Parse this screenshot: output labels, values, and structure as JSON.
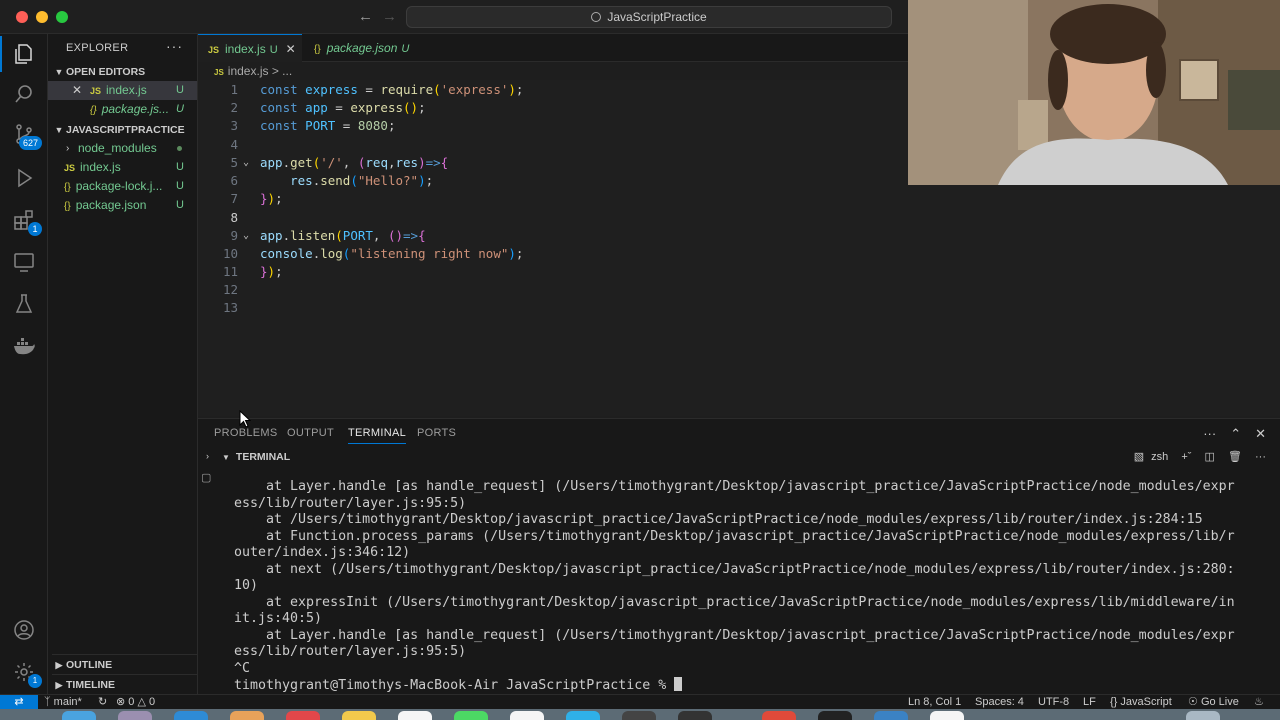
{
  "window": {
    "search_title": "JavaScriptPractice",
    "back_icon": "arrow-left-icon",
    "forward_icon": "arrow-right-icon"
  },
  "activity_bar": {
    "source_control_badge": "627",
    "extensions_badge": "1"
  },
  "sidebar": {
    "title": "EXPLORER",
    "open_editors_label": "OPEN EDITORS",
    "open_editors": [
      {
        "name": "index.js",
        "status": "U",
        "type": "js"
      },
      {
        "name": "package.js...",
        "status": "U",
        "type": "json"
      }
    ],
    "project_label": "JAVASCRIPTPRACTICE",
    "files": [
      {
        "name": "node_modules",
        "status": "",
        "type": "folder"
      },
      {
        "name": "index.js",
        "status": "U",
        "type": "js"
      },
      {
        "name": "package-lock.j...",
        "status": "U",
        "type": "json"
      },
      {
        "name": "package.json",
        "status": "U",
        "type": "json"
      }
    ],
    "outline_label": "OUTLINE",
    "timeline_label": "TIMELINE"
  },
  "tabs": [
    {
      "icon": "JS",
      "label": "index.js",
      "status": "U",
      "active": true
    },
    {
      "icon": "{}",
      "label": "package.json",
      "status": "U",
      "active": false
    }
  ],
  "breadcrumb": {
    "icon": "JS",
    "file": "index.js",
    "sep": "> ..."
  },
  "code": {
    "line_numbers": [
      "1",
      "2",
      "3",
      "4",
      "5",
      "6",
      "7",
      "8",
      "9",
      "10",
      "11",
      "12",
      "13"
    ]
  },
  "panel": {
    "tabs": [
      "PROBLEMS",
      "OUTPUT",
      "TERMINAL",
      "PORTS"
    ],
    "active_tab": "TERMINAL",
    "terminal_title": "TERMINAL",
    "shell": "zsh",
    "terminal_lines": [
      "    at Layer.handle [as handle_request] (/Users/timothygrant/Desktop/javascript_practice/JavaScriptPractice/node_modules/expr",
      "ess/lib/router/layer.js:95:5)",
      "    at /Users/timothygrant/Desktop/javascript_practice/JavaScriptPractice/node_modules/express/lib/router/index.js:284:15",
      "    at Function.process_params (/Users/timothygrant/Desktop/javascript_practice/JavaScriptPractice/node_modules/express/lib/r",
      "outer/index.js:346:12)",
      "    at next (/Users/timothygrant/Desktop/javascript_practice/JavaScriptPractice/node_modules/express/lib/router/index.js:280:",
      "10)",
      "    at expressInit (/Users/timothygrant/Desktop/javascript_practice/JavaScriptPractice/node_modules/express/lib/middleware/in",
      "it.js:40:5)",
      "    at Layer.handle [as handle_request] (/Users/timothygrant/Desktop/javascript_practice/JavaScriptPractice/node_modules/expr",
      "ess/lib/router/layer.js:95:5)",
      "^C"
    ],
    "prompt": "timothygrant@Timothys-MacBook-Air JavaScriptPractice % "
  },
  "status_bar": {
    "branch": "main*",
    "errors": "0",
    "warnings": "0",
    "position": "Ln 8, Col 1",
    "spaces": "Spaces: 4",
    "encoding": "UTF-8",
    "eol": "LF",
    "language": "JavaScript",
    "go_live": "Go Live"
  },
  "colors": {
    "accent": "#0078d4",
    "untracked": "#73c991",
    "js_icon": "#cbcb41"
  }
}
